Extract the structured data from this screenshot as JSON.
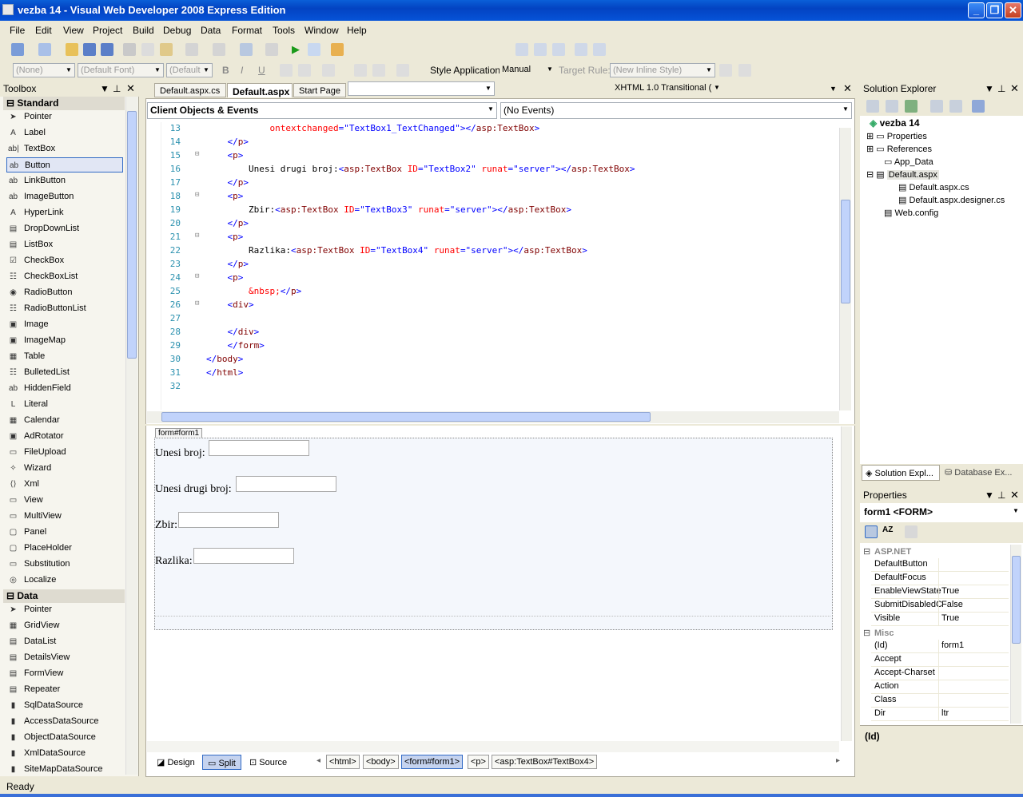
{
  "window": {
    "title": "vezba 14 - Visual Web Developer 2008 Express Edition",
    "controls": [
      "_",
      "❐",
      "✕"
    ]
  },
  "menu": [
    "File",
    "Edit",
    "View",
    "Project",
    "Build",
    "Debug",
    "Data",
    "Format",
    "Tools",
    "Window",
    "Help"
  ],
  "toolbar": {
    "doctype": "XHTML 1.0 Transitional (",
    "block_format": "(None)",
    "font": "(Default Font)",
    "size": "(Default",
    "bold": "B",
    "italic": "I",
    "underline": "U",
    "style_application_label": "Style Application:",
    "style_application_value": "Manual",
    "target_rule_label": "Target Rule:",
    "target_rule_value": "(New Inline Style)"
  },
  "toolbox": {
    "title": "Toolbox",
    "standard_group": "Standard",
    "standard_items": [
      "Pointer",
      "Label",
      "TextBox",
      "Button",
      "LinkButton",
      "ImageButton",
      "HyperLink",
      "DropDownList",
      "ListBox",
      "CheckBox",
      "CheckBoxList",
      "RadioButton",
      "RadioButtonList",
      "Image",
      "ImageMap",
      "Table",
      "BulletedList",
      "HiddenField",
      "Literal",
      "Calendar",
      "AdRotator",
      "FileUpload",
      "Wizard",
      "Xml",
      "View",
      "MultiView",
      "Panel",
      "PlaceHolder",
      "Substitution",
      "Localize"
    ],
    "standard_icons": [
      "➤",
      "A",
      "ab|",
      "ab",
      "ab",
      "ab",
      "A",
      "▤",
      "▤",
      "☑",
      "☷",
      "◉",
      "☷",
      "▣",
      "▣",
      "▦",
      "☷",
      "ab",
      "L",
      "▦",
      "▣",
      "▭",
      "✧",
      "⟨⟩",
      "▭",
      "▭",
      "▢",
      "▢",
      "▭",
      "◎"
    ],
    "selected": "Button",
    "data_group": "Data",
    "data_items": [
      "Pointer",
      "GridView",
      "DataList",
      "DetailsView",
      "FormView",
      "Repeater",
      "SqlDataSource",
      "AccessDataSource",
      "ObjectDataSource",
      "XmlDataSource",
      "SiteMapDataSource"
    ],
    "data_icons": [
      "➤",
      "▦",
      "▤",
      "▤",
      "▤",
      "▤",
      "▮",
      "▮",
      "▮",
      "▮",
      "▮"
    ]
  },
  "editor": {
    "tabs": [
      "Default.aspx.cs",
      "Default.aspx",
      "Start Page"
    ],
    "active_tab": "Default.aspx",
    "object_combo": "Client Objects & Events",
    "event_combo": "(No Events)",
    "code_lines": [
      {
        "n": "13",
        "fold": "",
        "ind": "            ",
        "parts": [
          {
            "c": "t-attr",
            "t": "ontextchanged"
          },
          {
            "c": "t-br",
            "t": "=\"TextBox1_TextChanged\">"
          },
          {
            "c": "t-br",
            "t": "</"
          },
          {
            "c": "t-tag",
            "t": "asp:TextBox"
          },
          {
            "c": "t-br",
            "t": ">"
          }
        ]
      },
      {
        "n": "14",
        "fold": "",
        "ind": "    ",
        "parts": [
          {
            "c": "t-br",
            "t": "</"
          },
          {
            "c": "t-tag",
            "t": "p"
          },
          {
            "c": "t-br",
            "t": ">"
          }
        ]
      },
      {
        "n": "15",
        "fold": "⊟",
        "ind": "    ",
        "parts": [
          {
            "c": "t-br",
            "t": "<"
          },
          {
            "c": "t-tag",
            "t": "p"
          },
          {
            "c": "t-br",
            "t": ">"
          }
        ]
      },
      {
        "n": "16",
        "fold": "",
        "ind": "        ",
        "parts": [
          {
            "c": "",
            "t": "Unesi drugi broj:"
          },
          {
            "c": "t-br",
            "t": "<"
          },
          {
            "c": "t-tag",
            "t": "asp:TextBox"
          },
          {
            "c": "",
            "t": " "
          },
          {
            "c": "t-attr",
            "t": "ID"
          },
          {
            "c": "t-br",
            "t": "=\"TextBox2\""
          },
          {
            "c": "",
            "t": " "
          },
          {
            "c": "t-attr",
            "t": "runat"
          },
          {
            "c": "t-br",
            "t": "=\"server\"></"
          },
          {
            "c": "t-tag",
            "t": "asp:TextBox"
          },
          {
            "c": "t-br",
            "t": ">"
          }
        ]
      },
      {
        "n": "17",
        "fold": "",
        "ind": "    ",
        "parts": [
          {
            "c": "t-br",
            "t": "</"
          },
          {
            "c": "t-tag",
            "t": "p"
          },
          {
            "c": "t-br",
            "t": ">"
          }
        ]
      },
      {
        "n": "18",
        "fold": "⊟",
        "ind": "    ",
        "parts": [
          {
            "c": "t-br",
            "t": "<"
          },
          {
            "c": "t-tag",
            "t": "p"
          },
          {
            "c": "t-br",
            "t": ">"
          }
        ]
      },
      {
        "n": "19",
        "fold": "",
        "ind": "        ",
        "parts": [
          {
            "c": "",
            "t": "Zbir:"
          },
          {
            "c": "t-br",
            "t": "<"
          },
          {
            "c": "t-tag",
            "t": "asp:TextBox"
          },
          {
            "c": "",
            "t": " "
          },
          {
            "c": "t-attr",
            "t": "ID"
          },
          {
            "c": "t-br",
            "t": "=\"TextBox3\""
          },
          {
            "c": "",
            "t": " "
          },
          {
            "c": "t-attr",
            "t": "runat"
          },
          {
            "c": "t-br",
            "t": "=\"server\"></"
          },
          {
            "c": "t-tag",
            "t": "asp:TextBox"
          },
          {
            "c": "t-br",
            "t": ">"
          }
        ]
      },
      {
        "n": "20",
        "fold": "",
        "ind": "    ",
        "parts": [
          {
            "c": "t-br",
            "t": "</"
          },
          {
            "c": "t-tag",
            "t": "p"
          },
          {
            "c": "t-br",
            "t": ">"
          }
        ]
      },
      {
        "n": "21",
        "fold": "⊟",
        "ind": "    ",
        "parts": [
          {
            "c": "t-br",
            "t": "<"
          },
          {
            "c": "t-tag",
            "t": "p"
          },
          {
            "c": "t-br",
            "t": ">"
          }
        ]
      },
      {
        "n": "22",
        "fold": "",
        "ind": "        ",
        "parts": [
          {
            "c": "",
            "t": "Razlika:"
          },
          {
            "c": "t-br",
            "t": "<"
          },
          {
            "c": "t-tag",
            "t": "asp:TextBox"
          },
          {
            "c": "",
            "t": " "
          },
          {
            "c": "t-attr",
            "t": "ID"
          },
          {
            "c": "t-br",
            "t": "=\"TextBox4\""
          },
          {
            "c": "",
            "t": " "
          },
          {
            "c": "t-attr",
            "t": "runat"
          },
          {
            "c": "t-br",
            "t": "=\"server\"></"
          },
          {
            "c": "t-tag",
            "t": "asp:TextBox"
          },
          {
            "c": "t-br",
            "t": ">"
          }
        ]
      },
      {
        "n": "23",
        "fold": "",
        "ind": "    ",
        "parts": [
          {
            "c": "t-br",
            "t": "</"
          },
          {
            "c": "t-tag",
            "t": "p"
          },
          {
            "c": "t-br",
            "t": ">"
          }
        ]
      },
      {
        "n": "24",
        "fold": "⊟",
        "ind": "    ",
        "parts": [
          {
            "c": "t-br",
            "t": "<"
          },
          {
            "c": "t-tag",
            "t": "p"
          },
          {
            "c": "t-br",
            "t": ">"
          }
        ]
      },
      {
        "n": "25",
        "fold": "",
        "ind": "        ",
        "parts": [
          {
            "c": "t-attr",
            "t": "&nbsp;"
          },
          {
            "c": "t-br",
            "t": "</"
          },
          {
            "c": "t-tag",
            "t": "p"
          },
          {
            "c": "t-br",
            "t": ">"
          }
        ]
      },
      {
        "n": "26",
        "fold": "⊟",
        "ind": "    ",
        "parts": [
          {
            "c": "t-br",
            "t": "<"
          },
          {
            "c": "t-tag",
            "t": "div"
          },
          {
            "c": "t-br",
            "t": ">"
          }
        ]
      },
      {
        "n": "27",
        "fold": "",
        "ind": "",
        "parts": []
      },
      {
        "n": "28",
        "fold": "",
        "ind": "    ",
        "parts": [
          {
            "c": "t-br",
            "t": "</"
          },
          {
            "c": "t-tag",
            "t": "div"
          },
          {
            "c": "t-br",
            "t": ">"
          }
        ]
      },
      {
        "n": "29",
        "fold": "",
        "ind": "    ",
        "parts": [
          {
            "c": "t-br",
            "t": "</"
          },
          {
            "c": "t-tag",
            "t": "form"
          },
          {
            "c": "t-br",
            "t": ">"
          }
        ]
      },
      {
        "n": "30",
        "fold": "",
        "ind": "",
        "parts": [
          {
            "c": "t-br",
            "t": "</"
          },
          {
            "c": "t-tag",
            "t": "body"
          },
          {
            "c": "t-br",
            "t": ">"
          }
        ]
      },
      {
        "n": "31",
        "fold": "",
        "ind": "",
        "parts": [
          {
            "c": "t-br",
            "t": "</"
          },
          {
            "c": "t-tag",
            "t": "html"
          },
          {
            "c": "t-br",
            "t": ">"
          }
        ]
      },
      {
        "n": "32",
        "fold": "",
        "ind": "",
        "parts": []
      }
    ]
  },
  "design": {
    "form_tag": "form#form1",
    "labels": [
      "Unesi broj:",
      "Unesi drugi broj:",
      "Zbir:",
      "Razlika:"
    ]
  },
  "bottom": {
    "view_tabs": [
      "Design",
      "Split",
      "Source"
    ],
    "active_view": "Split",
    "breadcrumbs": [
      "<html>",
      "<body>",
      "<form#form1>",
      "<p>",
      "<asp:TextBox#TextBox4>"
    ],
    "active_crumb": "<form#form1>"
  },
  "solution": {
    "title": "Solution Explorer",
    "project": "vezba 14",
    "items": [
      "Properties",
      "References",
      "App_Data",
      "Default.aspx",
      "Default.aspx.cs",
      "Default.aspx.designer.cs",
      "Web.config"
    ],
    "tab_solution": "Solution Expl...",
    "tab_database": "Database Ex..."
  },
  "properties": {
    "title": "Properties",
    "object": "form1  <FORM>",
    "cat_aspnet": "ASP.NET",
    "aspnet_rows": [
      {
        "name": "DefaultButton",
        "value": ""
      },
      {
        "name": "DefaultFocus",
        "value": ""
      },
      {
        "name": "EnableViewState",
        "value": "True"
      },
      {
        "name": "SubmitDisabledC",
        "value": "False"
      },
      {
        "name": "Visible",
        "value": "True"
      }
    ],
    "cat_misc": "Misc",
    "misc_rows": [
      {
        "name": "(Id)",
        "value": "form1"
      },
      {
        "name": "Accept",
        "value": ""
      },
      {
        "name": "Accept-Charset",
        "value": ""
      },
      {
        "name": "Action",
        "value": ""
      },
      {
        "name": "Class",
        "value": ""
      },
      {
        "name": "Dir",
        "value": "ltr"
      }
    ],
    "description": "(Id)"
  },
  "status": "Ready"
}
